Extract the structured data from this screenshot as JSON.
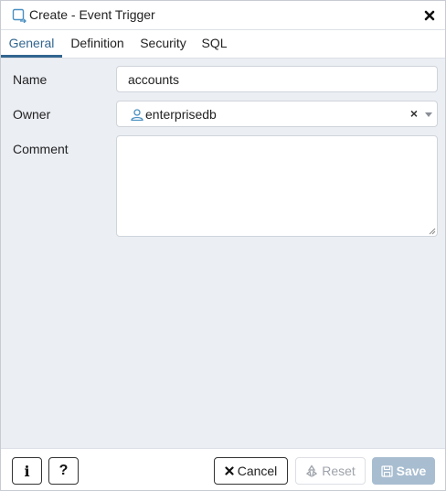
{
  "dialog": {
    "title": "Create - Event Trigger",
    "title_icon": "event-trigger-icon",
    "close_icon": "close-icon"
  },
  "tabs": [
    {
      "label": "General",
      "active": true
    },
    {
      "label": "Definition",
      "active": false
    },
    {
      "label": "Security",
      "active": false
    },
    {
      "label": "SQL",
      "active": false
    }
  ],
  "form": {
    "name": {
      "label": "Name",
      "value": "accounts"
    },
    "owner": {
      "label": "Owner",
      "value": "enterprisedb",
      "icon": "user-icon",
      "clear_glyph": "×"
    },
    "comment": {
      "label": "Comment",
      "value": ""
    }
  },
  "footer": {
    "info_glyph": "i",
    "help_glyph": "?",
    "cancel": {
      "label": "Cancel",
      "icon": "close-icon"
    },
    "reset": {
      "label": "Reset",
      "icon": "recycle-icon"
    },
    "save": {
      "label": "Save",
      "icon": "save-icon"
    }
  },
  "colors": {
    "accent": "#326690",
    "panel_bg": "#ebeef3",
    "save_disabled": "#a8bdd0"
  }
}
